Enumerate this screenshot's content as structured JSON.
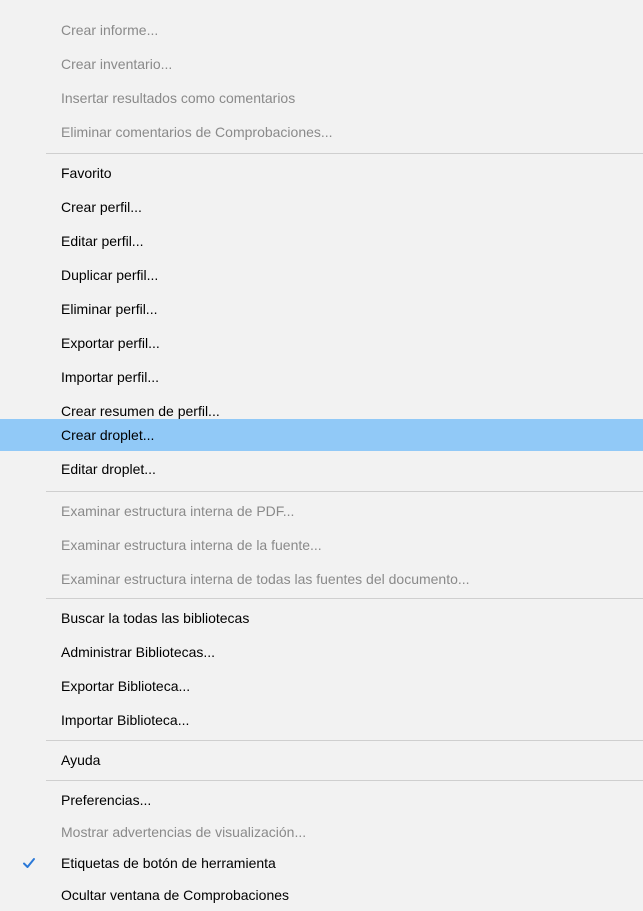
{
  "menu": {
    "groups": [
      {
        "items": [
          {
            "label": "Crear informe...",
            "enabled": false
          },
          {
            "label": "Crear inventario...",
            "enabled": false
          },
          {
            "label": "Insertar resultados como comentarios",
            "enabled": false
          },
          {
            "label": "Eliminar comentarios de Comprobaciones...",
            "enabled": false
          }
        ]
      },
      {
        "items": [
          {
            "label": "Favorito",
            "enabled": true
          },
          {
            "label": "Crear perfil...",
            "enabled": true
          },
          {
            "label": "Editar perfil...",
            "enabled": true
          },
          {
            "label": "Duplicar perfil...",
            "enabled": true
          },
          {
            "label": "Eliminar perfil...",
            "enabled": true
          },
          {
            "label": "Exportar perfil...",
            "enabled": true
          },
          {
            "label": "Importar perfil...",
            "enabled": true
          },
          {
            "label": "Crear resumen de perfil...",
            "enabled": true
          },
          {
            "label": "Crear droplet...",
            "enabled": true,
            "highlighted": true
          },
          {
            "label": "Editar droplet...",
            "enabled": true
          }
        ]
      },
      {
        "items": [
          {
            "label": "Examinar estructura interna de PDF...",
            "enabled": false
          },
          {
            "label": "Examinar estructura interna de la fuente...",
            "enabled": false
          },
          {
            "label": "Examinar estructura interna de todas las fuentes del documento...",
            "enabled": false
          }
        ]
      },
      {
        "items": [
          {
            "label": "Buscar la todas las bibliotecas",
            "enabled": true
          },
          {
            "label": "Administrar Bibliotecas...",
            "enabled": true
          },
          {
            "label": "Exportar Biblioteca...",
            "enabled": true
          },
          {
            "label": "Importar Biblioteca...",
            "enabled": true
          }
        ]
      },
      {
        "items": [
          {
            "label": "Ayuda",
            "enabled": true
          }
        ]
      },
      {
        "items": [
          {
            "label": "Preferencias...",
            "enabled": true
          },
          {
            "label": "Mostrar advertencias de visualización...",
            "enabled": false
          },
          {
            "label": "Etiquetas de botón de herramienta",
            "enabled": true,
            "checked": true,
            "icon": "checkmark-icon"
          },
          {
            "label": "Ocultar ventana de Comprobaciones",
            "enabled": true
          }
        ]
      }
    ]
  },
  "colors": {
    "menu_background": "#f2f2f2",
    "highlight": "#91c9f7",
    "disabled_text": "#8a8a8a",
    "enabled_text": "#000000",
    "separator": "#cfcfcf",
    "checkmark": "#2b79d8"
  }
}
